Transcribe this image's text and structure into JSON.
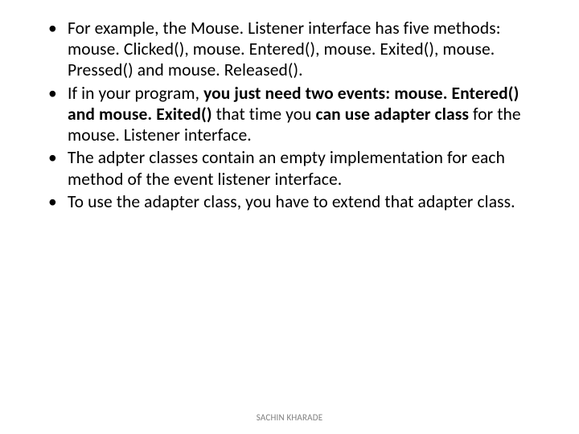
{
  "bullets": [
    {
      "runs": [
        {
          "t": "For example, the Mouse. Listener interface has five methods: mouse. Clicked(), mouse. Entered(), mouse. Exited(), mouse. Pressed() and mouse. Released().",
          "b": false
        }
      ]
    },
    {
      "runs": [
        {
          "t": "If in your program, ",
          "b": false
        },
        {
          "t": "you just need two events: mouse. Entered() and mouse. Exited() ",
          "b": true
        },
        {
          "t": "that time you ",
          "b": false
        },
        {
          "t": "can use adapter class ",
          "b": true
        },
        {
          "t": "for the mouse. Listener interface.",
          "b": false
        }
      ]
    },
    {
      "runs": [
        {
          "t": "The adpter classes contain an empty implementation for each method of the event listener interface.",
          "b": false
        }
      ]
    },
    {
      "runs": [
        {
          "t": "To use the adapter class, you have to extend that adapter class.",
          "b": false
        }
      ]
    }
  ],
  "footer": "SACHIN KHARADE"
}
